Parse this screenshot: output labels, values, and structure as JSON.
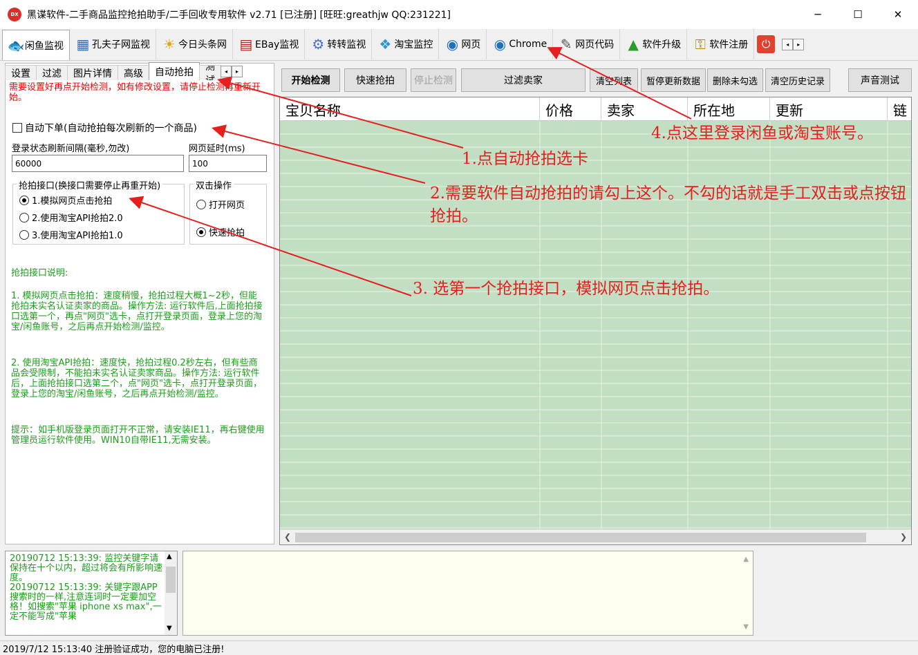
{
  "window": {
    "title": "黑谍软件-二手商品监控抢拍助手/二手回收专用软件 v2.71 [已注册] [旺旺:greathjw QQ:231221]",
    "minimize": "─",
    "maximize": "☐",
    "close": "✕"
  },
  "toolbar": {
    "tabs": [
      {
        "label": "闲鱼监视",
        "icon": "fish-icon"
      },
      {
        "label": "孔夫子网监视",
        "icon": "book-icon"
      },
      {
        "label": "今日头条网",
        "icon": "news-icon"
      },
      {
        "label": "EBay监视",
        "icon": "bag-icon"
      },
      {
        "label": "转转监视",
        "icon": "gear-icon"
      },
      {
        "label": "淘宝监控",
        "icon": "cube-icon"
      },
      {
        "label": "网页",
        "icon": "globe-icon"
      },
      {
        "label": "Chrome",
        "icon": "chrome-icon"
      },
      {
        "label": "网页代码",
        "icon": "code-icon"
      },
      {
        "label": "软件升级",
        "icon": "upgrade-icon"
      },
      {
        "label": "软件注册",
        "icon": "key-icon"
      }
    ],
    "scroll_left": "◂",
    "scroll_right": "▸"
  },
  "subtabs": [
    "设置",
    "过滤",
    "图片详情",
    "高级",
    "自动抢拍",
    "测试"
  ],
  "auto_panel": {
    "warning": "需要设置好再点开始检测，如有修改设置，请停止检测再重新开始。",
    "auto_order_label": "自动下单(自动抢拍每次刷新的一个商品)",
    "refresh_label": "登录状态刷新间隔(毫秒,勿改)",
    "refresh_value": "60000",
    "delay_label": "网页延时(ms)",
    "delay_value": "100",
    "api_group_title": "抢拍接口(换接口需要停止再重开始)",
    "api_options": [
      "1.模拟网页点击抢拍",
      "2.使用淘宝API抢拍2.0",
      "3.使用淘宝API抢拍1.0"
    ],
    "dbl_group_title": "双击操作",
    "dbl_options": [
      "打开网页",
      "快速抢拍"
    ],
    "desc_title": "抢拍接口说明:",
    "desc1": "1. 模拟网页点击抢拍：速度稍慢，抢拍过程大概1~2秒，但能抢拍未实名认证卖家的商品。操作方法: 运行软件后,上面抢拍接口选第一个，再点\"网页\"选卡，点打开登录页面，登录上您的淘宝/闲鱼账号，之后再点开始检测/监控。",
    "desc2": "2. 使用淘宝API抢拍：速度快，抢拍过程0.2秒左右，但有些商品会受限制，不能拍未实名认证卖家商品。操作方法: 运行软件后，上面抢拍接口选第二个，点\"网页\"选卡，点打开登录页面，登录上您的淘宝/闲鱼账号，之后再点开始检测/监控。",
    "desc3": "提示：如手机版登录页面打开不正常，请安装IE11，再右键使用管理员运行软件使用。WIN10自带IE11,无需安装。"
  },
  "buttons": {
    "start": "开始检测",
    "quick": "快速抢拍",
    "stop": "停止检测",
    "filter_seller": "过滤卖家",
    "clear_list": "清空列表",
    "pause_update": "暂停更新数据",
    "delete_unchecked": "删除未勾选",
    "clear_history": "清空历史记录",
    "sound_test": "声音测试"
  },
  "grid": {
    "columns": [
      "宝贝名称",
      "价格",
      "卖家",
      "所在地",
      "更新",
      "链"
    ]
  },
  "log": {
    "text": "20190712 15:13:39: 监控关键字请保持在十个以内，超过将会有所影响速度。\n20190712 15:13:39: 关键字跟APP搜索时的一样,注意连词时一定要加空格！如搜索\"苹果 iphone xs max\",一定不能写成\"苹果"
  },
  "status": "2019/7/12 15:13:40  注册验证成功，您的电脑已注册!",
  "annotations": {
    "a1": "1.点自动抢拍选卡",
    "a2": "2.需要软件自动抢拍的请勾上这个。不勾的话就是手工双击或点按钮抢拍。",
    "a3": "3. 选第一个抢拍接口，模拟网页点击抢拍。",
    "a4": "4.点这里登录闲鱼或淘宝账号。"
  },
  "colors": {
    "grid_bg": "#c3dfc3",
    "annotation": "#e51e1e",
    "log_text": "#1a9e1a"
  }
}
